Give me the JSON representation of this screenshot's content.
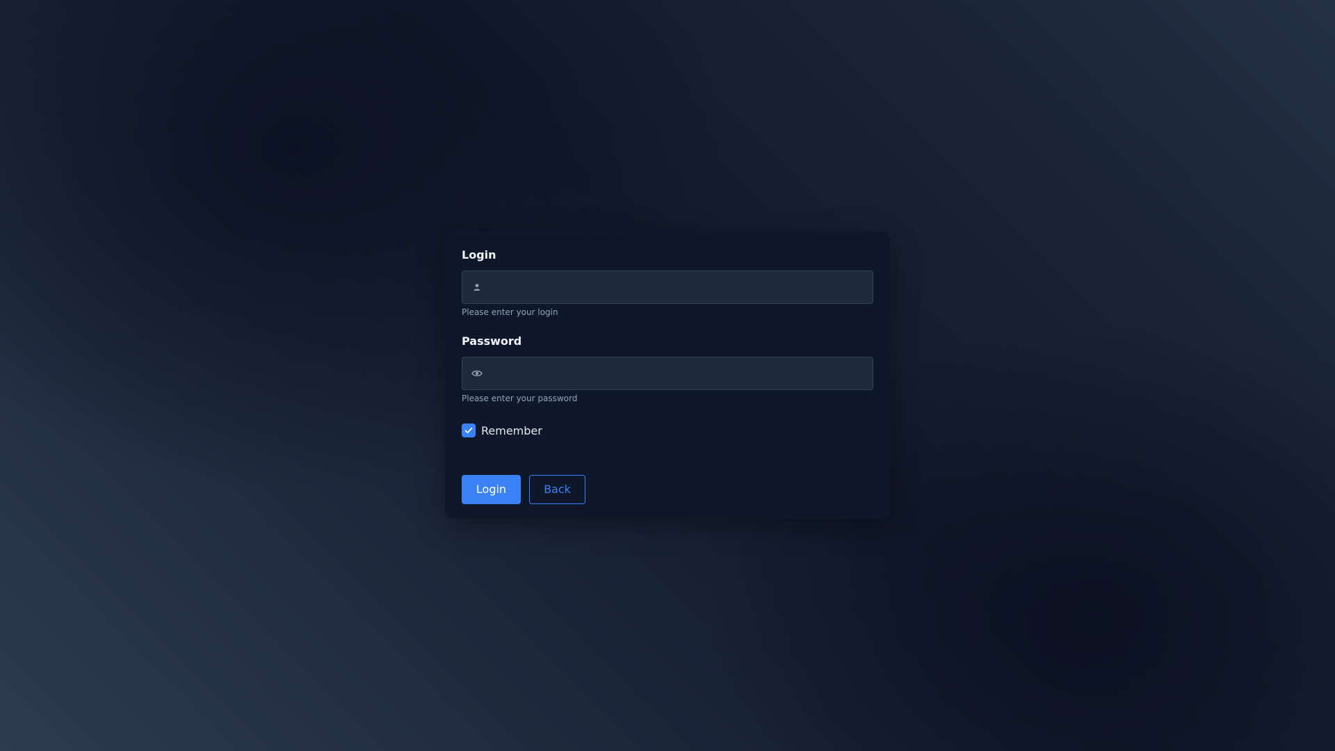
{
  "login_field": {
    "label": "Login",
    "value": "",
    "placeholder": "",
    "hint": "Please enter your login",
    "icon": "user-icon"
  },
  "password_field": {
    "label": "Password",
    "value": "",
    "placeholder": "",
    "hint": "Please enter your password",
    "icon": "eye-icon"
  },
  "remember": {
    "label": "Remember",
    "checked": true
  },
  "buttons": {
    "login_label": "Login",
    "back_label": "Back"
  },
  "colors": {
    "accent": "#3b82f6",
    "card_background": "#0f172a",
    "input_background": "#1e293b",
    "hint_text": "#94a3b8"
  }
}
